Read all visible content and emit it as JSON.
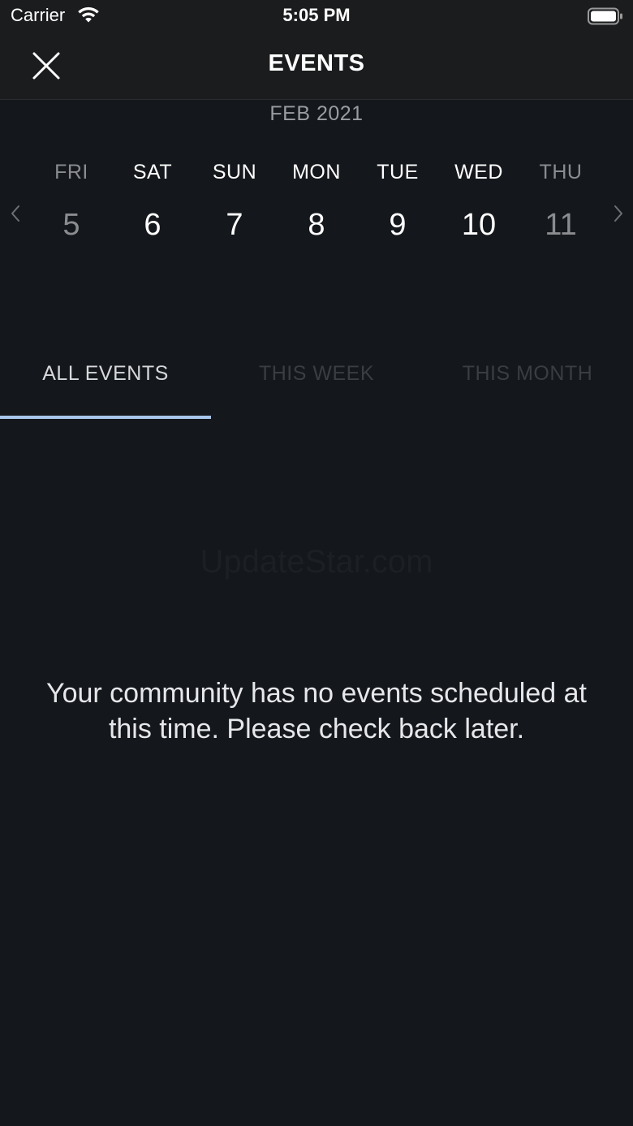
{
  "status_bar": {
    "carrier": "Carrier",
    "time": "5:05 PM",
    "wifi_icon": "wifi-icon",
    "battery_icon": "battery-icon"
  },
  "nav": {
    "title": "EVENTS",
    "close_icon": "close-icon"
  },
  "calendar": {
    "month": "FEB 2021",
    "prev_icon": "chevron-left-icon",
    "next_icon": "chevron-right-icon",
    "days": [
      {
        "name": "FRI",
        "number": "5"
      },
      {
        "name": "SAT",
        "number": "6"
      },
      {
        "name": "SUN",
        "number": "7"
      },
      {
        "name": "MON",
        "number": "8"
      },
      {
        "name": "TUE",
        "number": "9"
      },
      {
        "name": "WED",
        "number": "10"
      },
      {
        "name": "THU",
        "number": "11"
      }
    ]
  },
  "tabs": [
    {
      "label": "ALL EVENTS",
      "active": true
    },
    {
      "label": "THIS WEEK",
      "active": false
    },
    {
      "label": "THIS MONTH",
      "active": false
    }
  ],
  "watermark": "UpdateStar.com",
  "empty_state": {
    "message": "Your community has no events scheduled at this time. Please check back later."
  },
  "colors": {
    "background": "#14171b",
    "header": "#1b1c1e",
    "tab_accent": "#a9c6ec",
    "muted_text": "#8a8c90"
  }
}
